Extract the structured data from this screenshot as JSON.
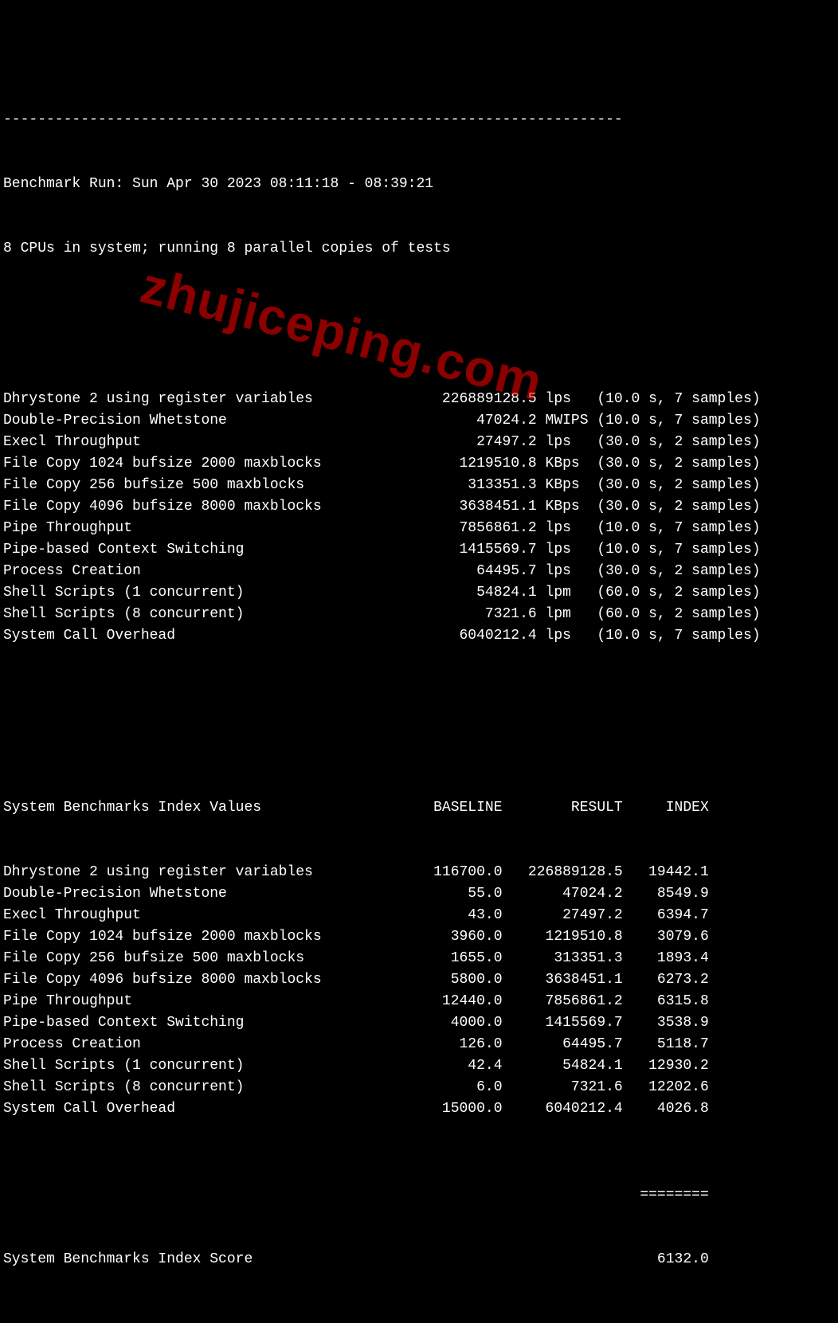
{
  "watermark": "zhujiceping.com",
  "header": {
    "dashes": "------------------------------------------------------------------------",
    "run_line": "Benchmark Run: Sun Apr 30 2023 08:11:18 - 08:39:21",
    "cpu_line": "8 CPUs in system; running 8 parallel copies of tests"
  },
  "results": [
    {
      "name": "Dhrystone 2 using register variables",
      "value": "226889128.5",
      "unit": "lps",
      "dur": "10.0",
      "samples": "7"
    },
    {
      "name": "Double-Precision Whetstone",
      "value": "47024.2",
      "unit": "MWIPS",
      "dur": "10.0",
      "samples": "7"
    },
    {
      "name": "Execl Throughput",
      "value": "27497.2",
      "unit": "lps",
      "dur": "30.0",
      "samples": "2"
    },
    {
      "name": "File Copy 1024 bufsize 2000 maxblocks",
      "value": "1219510.8",
      "unit": "KBps",
      "dur": "30.0",
      "samples": "2"
    },
    {
      "name": "File Copy 256 bufsize 500 maxblocks",
      "value": "313351.3",
      "unit": "KBps",
      "dur": "30.0",
      "samples": "2"
    },
    {
      "name": "File Copy 4096 bufsize 8000 maxblocks",
      "value": "3638451.1",
      "unit": "KBps",
      "dur": "30.0",
      "samples": "2"
    },
    {
      "name": "Pipe Throughput",
      "value": "7856861.2",
      "unit": "lps",
      "dur": "10.0",
      "samples": "7"
    },
    {
      "name": "Pipe-based Context Switching",
      "value": "1415569.7",
      "unit": "lps",
      "dur": "10.0",
      "samples": "7"
    },
    {
      "name": "Process Creation",
      "value": "64495.7",
      "unit": "lps",
      "dur": "30.0",
      "samples": "2"
    },
    {
      "name": "Shell Scripts (1 concurrent)",
      "value": "54824.1",
      "unit": "lpm",
      "dur": "60.0",
      "samples": "2"
    },
    {
      "name": "Shell Scripts (8 concurrent)",
      "value": "7321.6",
      "unit": "lpm",
      "dur": "60.0",
      "samples": "2"
    },
    {
      "name": "System Call Overhead",
      "value": "6040212.4",
      "unit": "lps",
      "dur": "10.0",
      "samples": "7"
    }
  ],
  "index_header": {
    "title": "System Benchmarks Index Values",
    "col_baseline": "BASELINE",
    "col_result": "RESULT",
    "col_index": "INDEX"
  },
  "index_rows": [
    {
      "name": "Dhrystone 2 using register variables",
      "baseline": "116700.0",
      "result": "226889128.5",
      "index": "19442.1"
    },
    {
      "name": "Double-Precision Whetstone",
      "baseline": "55.0",
      "result": "47024.2",
      "index": "8549.9"
    },
    {
      "name": "Execl Throughput",
      "baseline": "43.0",
      "result": "27497.2",
      "index": "6394.7"
    },
    {
      "name": "File Copy 1024 bufsize 2000 maxblocks",
      "baseline": "3960.0",
      "result": "1219510.8",
      "index": "3079.6"
    },
    {
      "name": "File Copy 256 bufsize 500 maxblocks",
      "baseline": "1655.0",
      "result": "313351.3",
      "index": "1893.4"
    },
    {
      "name": "File Copy 4096 bufsize 8000 maxblocks",
      "baseline": "5800.0",
      "result": "3638451.1",
      "index": "6273.2"
    },
    {
      "name": "Pipe Throughput",
      "baseline": "12440.0",
      "result": "7856861.2",
      "index": "6315.8"
    },
    {
      "name": "Pipe-based Context Switching",
      "baseline": "4000.0",
      "result": "1415569.7",
      "index": "3538.9"
    },
    {
      "name": "Process Creation",
      "baseline": "126.0",
      "result": "64495.7",
      "index": "5118.7"
    },
    {
      "name": "Shell Scripts (1 concurrent)",
      "baseline": "42.4",
      "result": "54824.1",
      "index": "12930.2"
    },
    {
      "name": "Shell Scripts (8 concurrent)",
      "baseline": "6.0",
      "result": "7321.6",
      "index": "12202.6"
    },
    {
      "name": "System Call Overhead",
      "baseline": "15000.0",
      "result": "6040212.4",
      "index": "4026.8"
    }
  ],
  "score": {
    "separator": "========",
    "label": "System Benchmarks Index Score",
    "value": "6132.0"
  }
}
